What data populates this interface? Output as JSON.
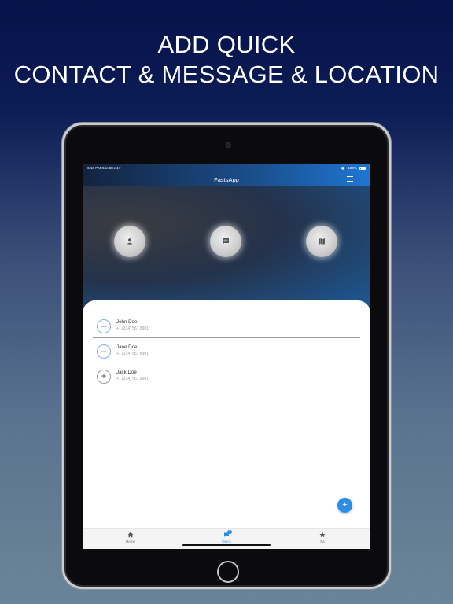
{
  "headline": {
    "line1": "ADD QUICK",
    "line2": "CONTACT & MESSAGE & LOCATION"
  },
  "status_bar": {
    "time": "6:10 PM",
    "date": "Sun Dec 17",
    "battery": "100%"
  },
  "navbar": {
    "title": "FastsApp"
  },
  "quick_actions": [
    {
      "icon": "person-icon"
    },
    {
      "icon": "message-icon"
    },
    {
      "icon": "map-icon"
    }
  ],
  "contacts": [
    {
      "name": "John Doe",
      "phone": "+1 (234) 567 8901",
      "action": "–"
    },
    {
      "name": "Jane Doe",
      "phone": "+1 (234) 567 8901",
      "action": "–"
    },
    {
      "name": "Jack Doe",
      "phone": "+1 (234) 567 8901",
      "action": "+"
    }
  ],
  "fab": {
    "label": "+"
  },
  "tabs": [
    {
      "label": "Home",
      "icon": "home-icon"
    },
    {
      "label": "Quick",
      "icon": "chat-icon",
      "badge": "3"
    },
    {
      "label": "Fa",
      "icon": "star-icon"
    }
  ],
  "colors": {
    "accent": "#2a8ee8",
    "nav_gradient_end": "#1e76d2"
  }
}
